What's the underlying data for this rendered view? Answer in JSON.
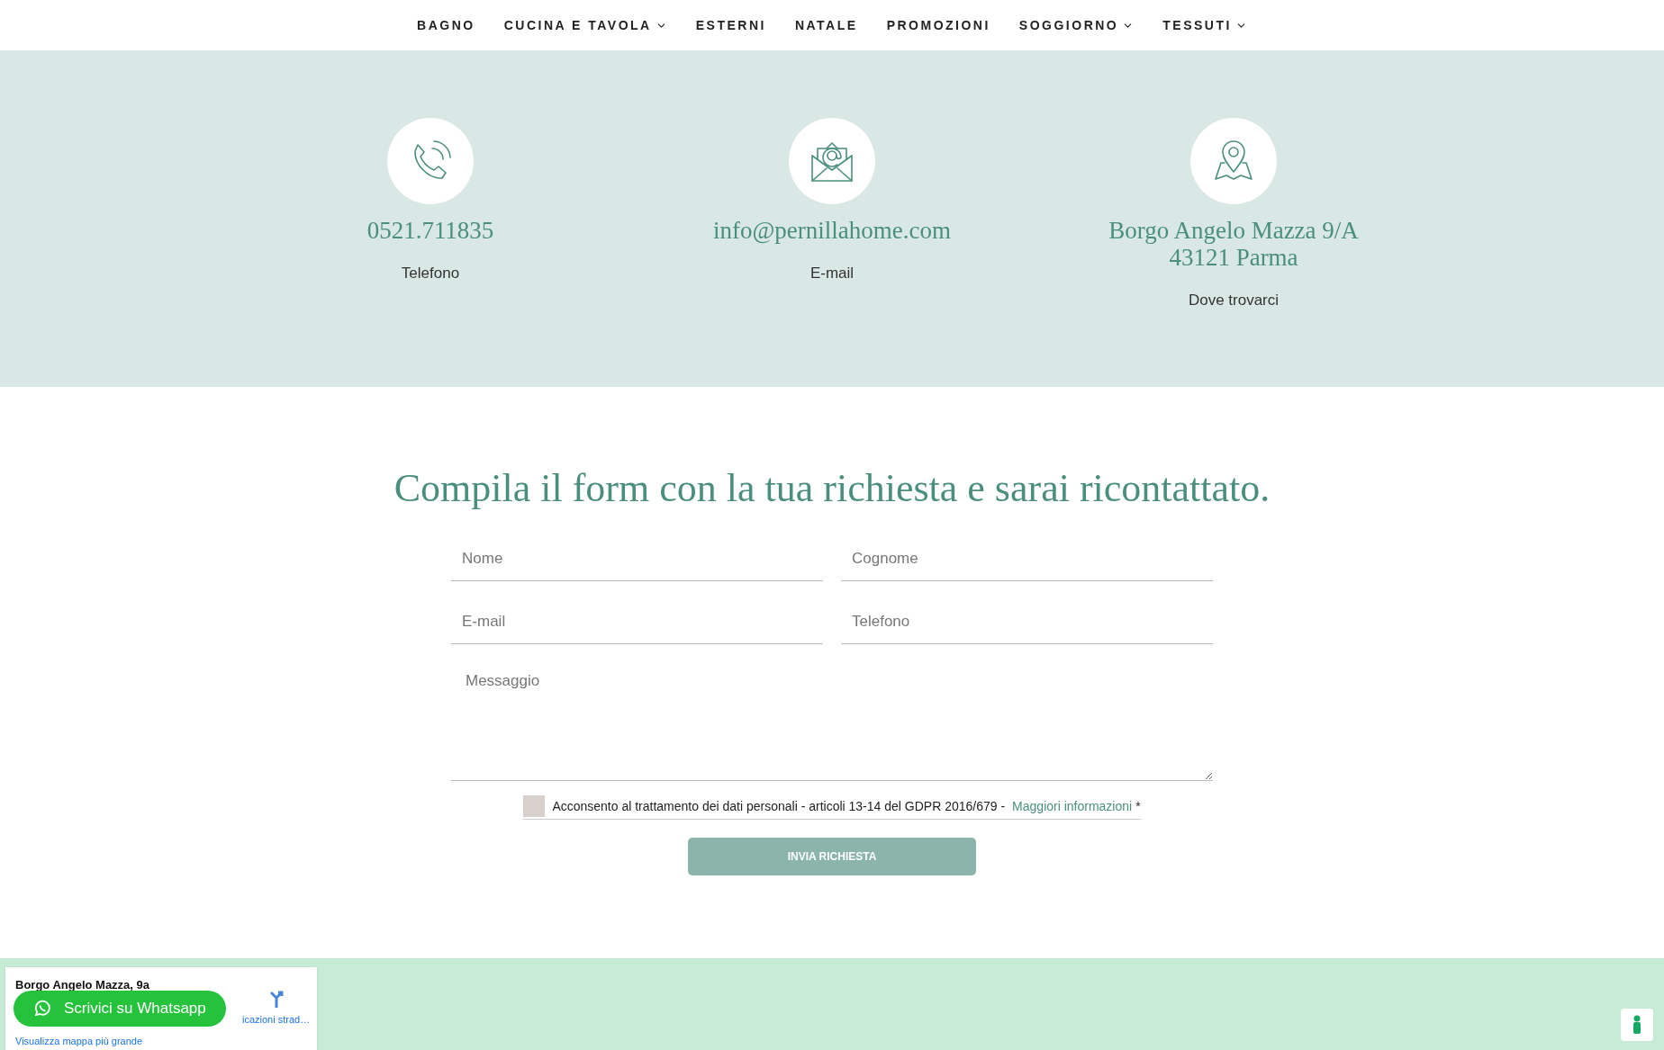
{
  "nav": [
    {
      "label": "BAGNO",
      "dropdown": false
    },
    {
      "label": "CUCINA E TAVOLA",
      "dropdown": true
    },
    {
      "label": "ESTERNI",
      "dropdown": false
    },
    {
      "label": "NATALE",
      "dropdown": false
    },
    {
      "label": "PROMOZIONI",
      "dropdown": false
    },
    {
      "label": "SOGGIORNO",
      "dropdown": true
    },
    {
      "label": "TESSUTI",
      "dropdown": true
    }
  ],
  "contacts": [
    {
      "kind": "phone",
      "value": [
        "0521.711835"
      ],
      "label": "Telefono"
    },
    {
      "kind": "email",
      "value": [
        "info@pernillahome.com"
      ],
      "label": "E-mail"
    },
    {
      "kind": "location",
      "value": [
        "Borgo Angelo Mazza 9/A",
        "43121 Parma"
      ],
      "label": "Dove trovarci"
    }
  ],
  "form": {
    "title": "Compila il form con la tua richiesta e sarai ricontattato.",
    "fields": [
      {
        "placeholder": "Nome"
      },
      {
        "placeholder": "Cognome"
      },
      {
        "placeholder": "E-mail"
      },
      {
        "placeholder": "Telefono"
      }
    ],
    "message": {
      "placeholder": "Messaggio"
    },
    "consent": {
      "checked": false,
      "text": "Acconsento al trattamento dei dati personali - articoli 13-14 del GDPR 2016/679 -",
      "link": "Maggiori informazioni",
      "required": "*"
    },
    "submit": "INVIA RICHIESTA"
  },
  "map": {
    "place": "Borgo Angelo Mazza, 9a",
    "directions": "icazioni strad…",
    "larger_map": "Visualizza mappa più grande"
  },
  "whatsapp": {
    "label": "Scrivici su Whatsapp"
  }
}
